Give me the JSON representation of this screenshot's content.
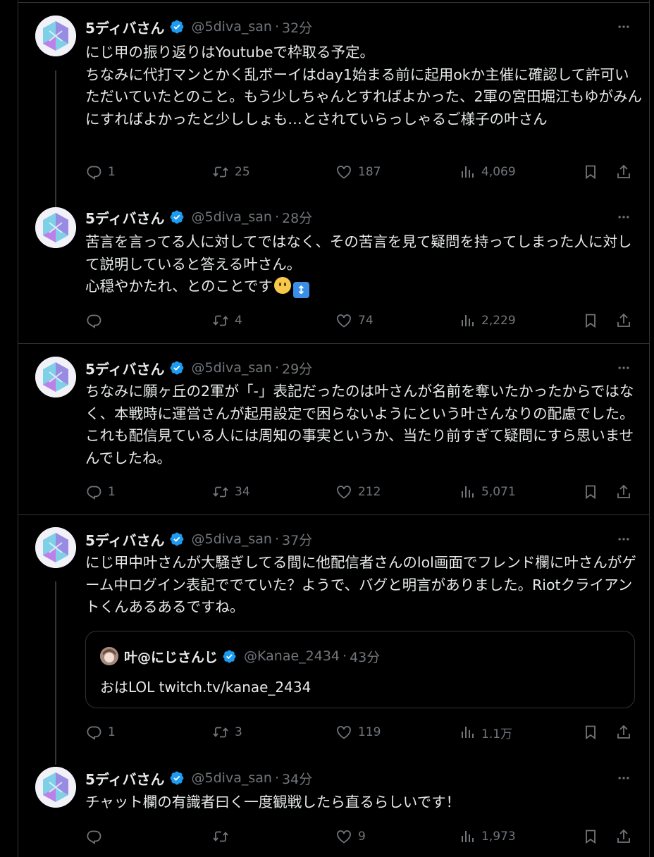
{
  "colors": {
    "background": "#000000",
    "text": "#e7e9ea",
    "muted": "#71767b",
    "border": "#2f3336",
    "verified": "#1d9bf0"
  },
  "icons": [
    "reply-icon",
    "retweet-icon",
    "like-icon",
    "views-icon",
    "bookmark-icon",
    "share-icon",
    "verified-badge-icon",
    "more-icon"
  ],
  "tweets": [
    {
      "name": "5ディバさん",
      "handle": "@5diva_san",
      "dot": "·",
      "time": "32分",
      "text": "にじ甲の振り返りはYoutubeで枠取る予定。\nちなみに代打マンとかく乱ボーイはday1始まる前に起用okか主催に確認して許可いただいていたとのこと。もう少しちゃんとすればよかった、2軍の宮田堀江もゆがみんにすればよかったと少ししょも…とされていらっしゃるご様子の叶さん",
      "replies": "1",
      "retweets": "25",
      "likes": "187",
      "views": "4,069"
    },
    {
      "name": "5ディバさん",
      "handle": "@5diva_san",
      "dot": "·",
      "time": "28分",
      "text": "苦言を言ってる人に対してではなく、その苦言を見て疑問を持ってしまった人に対して説明していると答える叶さん。\n心穏やかたれ、とのことです",
      "emoji_updown": "↕",
      "replies": "",
      "retweets": "4",
      "likes": "74",
      "views": "2,229"
    },
    {
      "name": "5ディバさん",
      "handle": "@5diva_san",
      "dot": "·",
      "time": "29分",
      "text": "ちなみに願ヶ丘の2軍が「-」表記だったのは叶さんが名前を奪いたかったからではなく、本戦時に運営さんが起用設定で困らないようにという叶さんなりの配慮でした。これも配信見ている人には周知の事実というか、当たり前すぎて疑問にすら思いませんでしたね。",
      "replies": "1",
      "retweets": "34",
      "likes": "212",
      "views": "5,071"
    },
    {
      "name": "5ディバさん",
      "handle": "@5diva_san",
      "dot": "·",
      "time": "37分",
      "text": "にじ甲中叶さんが大騒ぎしてる間に他配信者さんのlol画面でフレンド欄に叶さんがゲーム中ログイン表記ででていた？ようで、バグと明言がありました。Riotクライアントくんあるあるですね。",
      "quote": {
        "name": "叶@にじさんじ",
        "handle": "@Kanae_2434",
        "dot": "·",
        "time": "43分",
        "text": "おはLOL twitch.tv/kanae_2434"
      },
      "replies": "1",
      "retweets": "3",
      "likes": "119",
      "views": "1.1万"
    },
    {
      "name": "5ディバさん",
      "handle": "@5diva_san",
      "dot": "·",
      "time": "34分",
      "text": "チャット欄の有識者曰く一度観戦したら直るらしいです！",
      "replies": "",
      "retweets": "",
      "likes": "9",
      "views": "1,973"
    }
  ]
}
